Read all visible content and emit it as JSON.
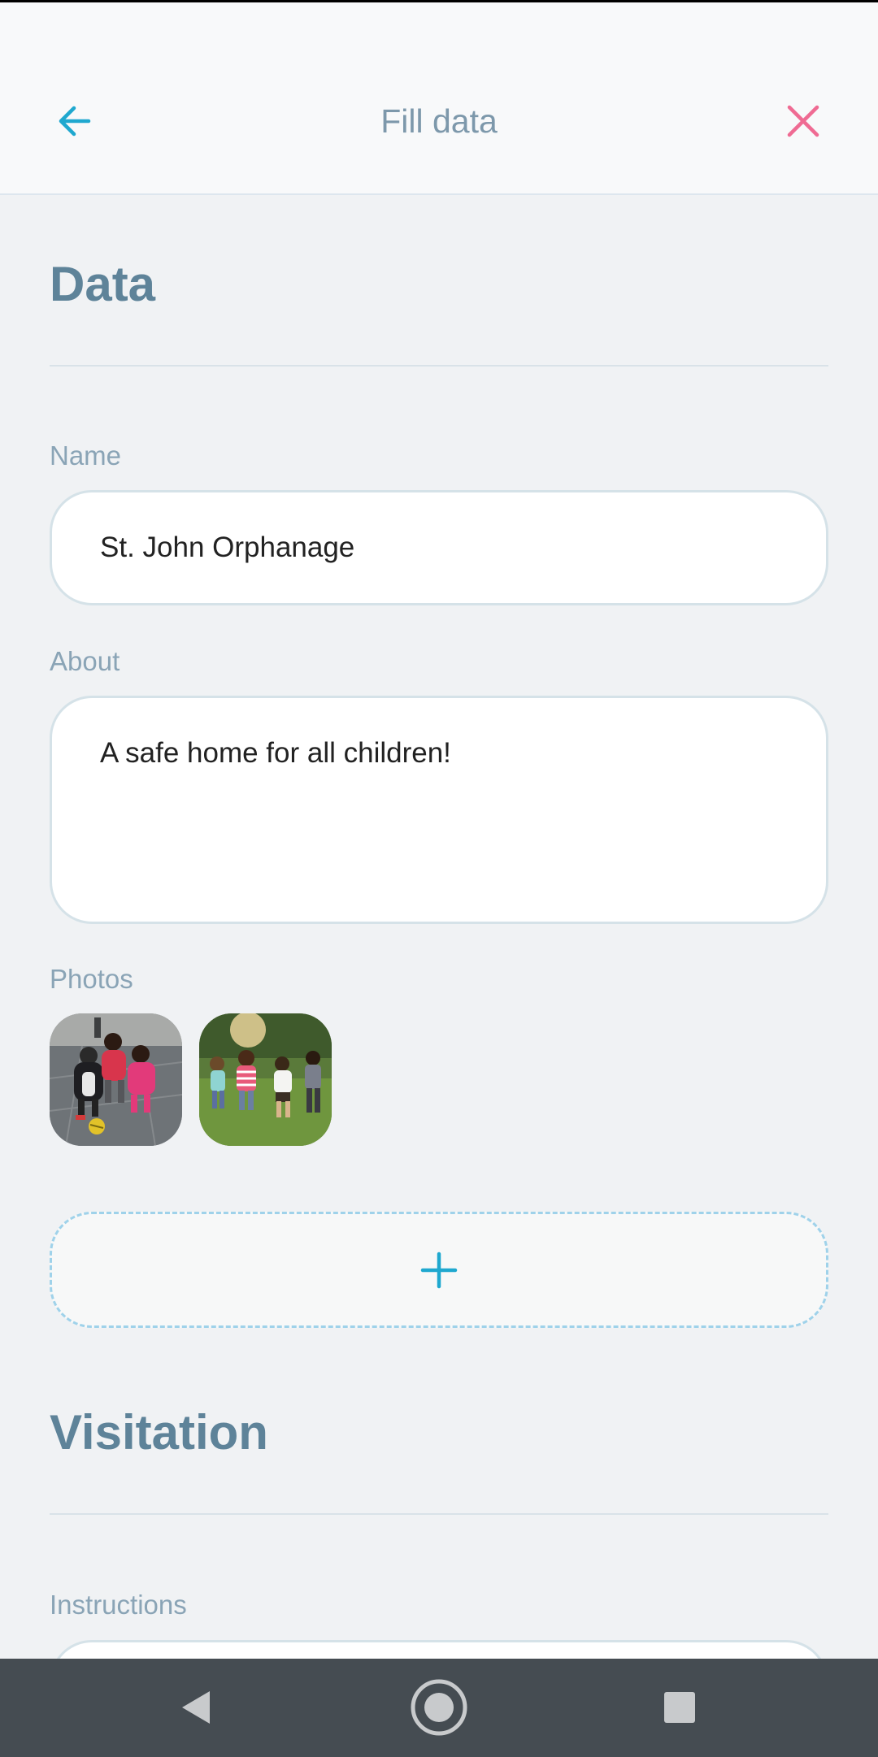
{
  "header": {
    "title": "Fill data",
    "back_icon": "arrow-left-icon",
    "close_icon": "close-icon",
    "accent_color": "#1fa8cf",
    "close_color": "#ef6b93"
  },
  "data_section": {
    "title": "Data",
    "name": {
      "label": "Name",
      "value": "St. John Orphanage"
    },
    "about": {
      "label": "About",
      "value": "A safe home for all children!"
    },
    "photos": {
      "label": "Photos",
      "items": [
        {
          "alt": "Children playing soccer"
        },
        {
          "alt": "Children running on grass"
        }
      ],
      "add_icon": "plus-icon"
    }
  },
  "visitation_section": {
    "title": "Visitation",
    "instructions": {
      "label": "Instructions",
      "value": ""
    }
  },
  "nav_bar": {
    "back_icon": "triangle-back-icon",
    "home_icon": "circle-home-icon",
    "recents_icon": "square-recents-icon"
  }
}
